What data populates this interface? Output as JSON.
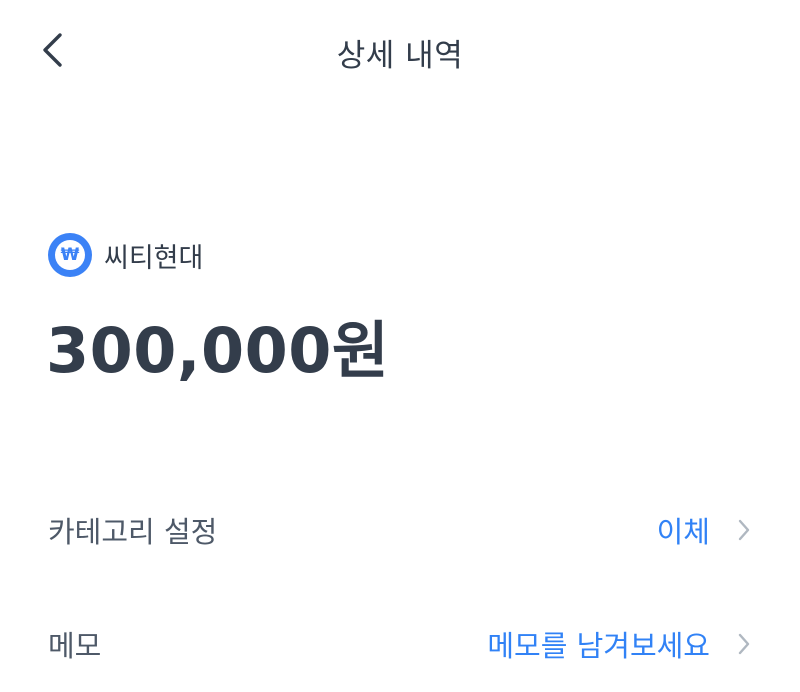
{
  "header": {
    "title": "상세 내역",
    "back_icon": "chevron-left-icon"
  },
  "account": {
    "logo_icon": "won-coin-icon",
    "logo_symbol": "₩",
    "name": "씨티현대",
    "brand_color": "#3b82f6"
  },
  "transaction": {
    "amount": "300,000원"
  },
  "details": {
    "category": {
      "label": "카테고리 설정",
      "value": "이체"
    },
    "memo": {
      "label": "메모",
      "value": "메모를 남겨보세요"
    }
  },
  "colors": {
    "accent": "#3182f6",
    "text_primary": "#333d4b",
    "text_secondary": "#4e5968",
    "chevron": "#b0b8c1"
  }
}
